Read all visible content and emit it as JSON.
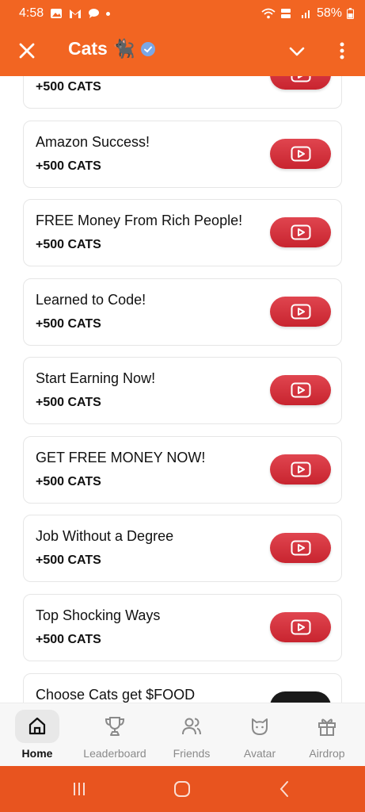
{
  "status_bar": {
    "time": "4:58",
    "battery": "58%"
  },
  "app_bar": {
    "title": "Cats 🐈‍⬛"
  },
  "tasks": [
    {
      "title": "",
      "reward": "+500 CATS"
    },
    {
      "title": "Amazon Success!",
      "reward": "+500 CATS"
    },
    {
      "title": "FREE Money From Rich People!",
      "reward": "+500 CATS"
    },
    {
      "title": "Learned to Code!",
      "reward": "+500 CATS"
    },
    {
      "title": "Start Earning Now!",
      "reward": "+500 CATS"
    },
    {
      "title": "GET FREE MONEY NOW!",
      "reward": "+500 CATS"
    },
    {
      "title": "Job Without a Degree",
      "reward": "+500 CATS"
    },
    {
      "title": "Top Shocking Ways",
      "reward": "+500 CATS"
    },
    {
      "title": "Choose Cats get $FOOD",
      "reward": ""
    }
  ],
  "bottom_nav": [
    {
      "label": "Home",
      "icon": "home-icon",
      "active": true
    },
    {
      "label": "Leaderboard",
      "icon": "trophy-icon",
      "active": false
    },
    {
      "label": "Friends",
      "icon": "friends-icon",
      "active": false
    },
    {
      "label": "Avatar",
      "icon": "cat-face-icon",
      "active": false
    },
    {
      "label": "Airdrop",
      "icon": "gift-icon",
      "active": false
    }
  ],
  "colors": {
    "brand": "#f26522",
    "play_button": "#d8333d",
    "system_nav": "#e8541f"
  }
}
